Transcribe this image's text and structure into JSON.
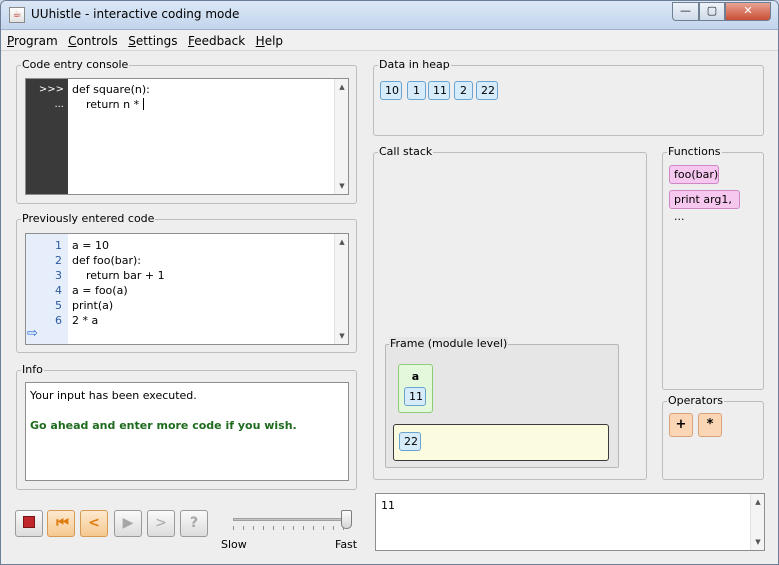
{
  "window": {
    "title": "UUhistle - interactive coding mode"
  },
  "menu": [
    "Program",
    "Controls",
    "Settings",
    "Feedback",
    "Help"
  ],
  "code_entry": {
    "label": "Code entry console",
    "prompts": [
      ">>>",
      "..."
    ],
    "lines": [
      "def square(n):",
      "    return n * "
    ]
  },
  "previous_code": {
    "label": "Previously entered code",
    "line_numbers": [
      "1",
      "2",
      "3",
      "4",
      "5",
      "6"
    ],
    "lines": [
      "a = 10",
      "def foo(bar):",
      "    return bar + 1",
      "a = foo(a)",
      "print(a)",
      "2 * a"
    ]
  },
  "info": {
    "label": "Info",
    "message": "Your input has been executed.",
    "hint": "Go ahead and enter more code if you wish.",
    "hint_color": "#1e6b1e"
  },
  "heap": {
    "label": "Data in heap",
    "values": [
      "10",
      "1",
      "11",
      "2",
      "22"
    ]
  },
  "call_stack": {
    "label": "Call stack",
    "frame_label": "Frame (module level)",
    "variable_name": "a",
    "variable_value": "11",
    "evaluation_value": "22"
  },
  "functions": {
    "label": "Functions",
    "items": [
      "foo(bar)",
      "print arg1, ..."
    ]
  },
  "operators": {
    "label": "Operators",
    "items": [
      "+",
      "*"
    ]
  },
  "speed": {
    "slow_label": "Slow",
    "fast_label": "Fast",
    "level": 1.0
  },
  "output": {
    "text": "11"
  },
  "colors": {
    "heap_value_fill": "#d6ecfb",
    "function_fill": "#f7c8ef",
    "operator_fill": "#fbd6b5",
    "variable_fill": "#e4f8dc",
    "evaluation_fill": "#fbfbdf",
    "stop_icon": "#c0272d",
    "rewind_icons": "#e07b10"
  },
  "icons": {
    "controls": [
      "stop-icon",
      "rewind-to-start-icon",
      "step-back-icon",
      "play-icon",
      "step-forward-icon",
      "help-question-icon"
    ]
  }
}
